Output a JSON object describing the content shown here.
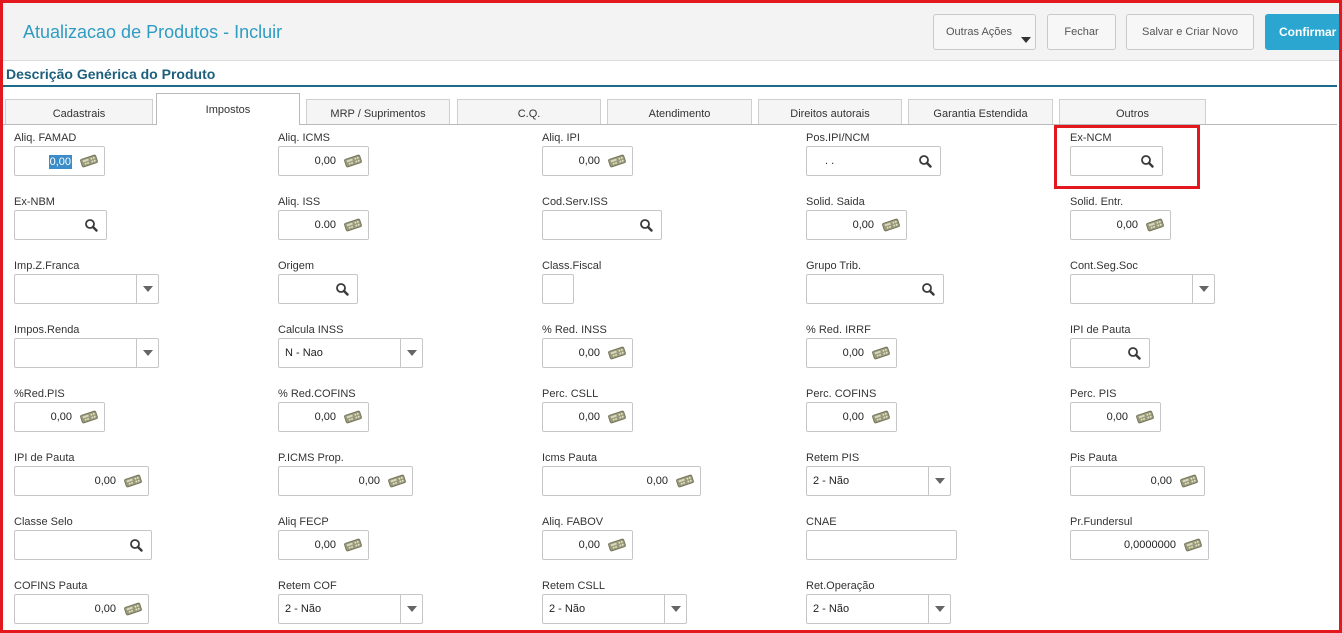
{
  "header": {
    "title": "Atualizacao de Produtos - Incluir",
    "buttons": {
      "outras": "Outras Ações",
      "fechar": "Fechar",
      "salvar": "Salvar e Criar Novo",
      "confirmar": "Confirmar"
    }
  },
  "section": {
    "title": "Descrição Genérica do Produto"
  },
  "tabs": [
    {
      "label": "Cadastrais"
    },
    {
      "label": "Impostos"
    },
    {
      "label": "MRP / Suprimentos"
    },
    {
      "label": "C.Q."
    },
    {
      "label": "Atendimento"
    },
    {
      "label": "Direitos autorais"
    },
    {
      "label": "Garantia Estendida"
    },
    {
      "label": "Outros"
    }
  ],
  "active_tab": "Impostos",
  "fields": {
    "aliq_famad": {
      "label": "Aliq. FAMAD",
      "value": "0,00"
    },
    "aliq_icms": {
      "label": "Aliq. ICMS",
      "value": "0,00"
    },
    "aliq_ipi": {
      "label": "Aliq. IPI",
      "value": "0,00"
    },
    "pos_ipi_ncm": {
      "label": "Pos.IPI/NCM",
      "value": ". ."
    },
    "ex_ncm": {
      "label": "Ex-NCM",
      "value": ""
    },
    "ex_nbm": {
      "label": "Ex-NBM",
      "value": ""
    },
    "aliq_iss": {
      "label": "Aliq. ISS",
      "value": "0.00"
    },
    "cod_serv_iss": {
      "label": "Cod.Serv.ISS",
      "value": ""
    },
    "solid_saida": {
      "label": "Solid. Saida",
      "value": "0,00"
    },
    "solid_entr": {
      "label": "Solid. Entr.",
      "value": "0,00"
    },
    "imp_z_franca": {
      "label": "Imp.Z.Franca",
      "value": ""
    },
    "origem": {
      "label": "Origem",
      "value": ""
    },
    "class_fiscal": {
      "label": "Class.Fiscal",
      "value": ""
    },
    "grupo_trib": {
      "label": "Grupo Trib.",
      "value": ""
    },
    "cont_seg_soc": {
      "label": "Cont.Seg.Soc",
      "value": ""
    },
    "impos_renda": {
      "label": "Impos.Renda",
      "value": ""
    },
    "calcula_inss": {
      "label": "Calcula INSS",
      "value": "N - Nao"
    },
    "red_inss": {
      "label": "% Red. INSS",
      "value": "0,00"
    },
    "red_irrf": {
      "label": "% Red. IRRF",
      "value": "0,00"
    },
    "ipi_pauta_1": {
      "label": "IPI de Pauta",
      "value": ""
    },
    "red_pis": {
      "label": "%Red.PIS",
      "value": "0,00"
    },
    "red_cofins": {
      "label": "% Red.COFINS",
      "value": "0,00"
    },
    "perc_csll": {
      "label": "Perc. CSLL",
      "value": "0,00"
    },
    "perc_cofins": {
      "label": "Perc. COFINS",
      "value": "0,00"
    },
    "perc_pis": {
      "label": "Perc. PIS",
      "value": "0,00"
    },
    "ipi_pauta_2": {
      "label": "IPI de Pauta",
      "value": "0,00"
    },
    "p_icms_prop": {
      "label": "P.ICMS Prop.",
      "value": "0,00"
    },
    "icms_pauta": {
      "label": "Icms Pauta",
      "value": "0,00"
    },
    "retem_pis": {
      "label": "Retem PIS",
      "value": "2 - Não"
    },
    "pis_pauta": {
      "label": "Pis Pauta",
      "value": "0,00"
    },
    "classe_selo": {
      "label": "Classe Selo",
      "value": ""
    },
    "aliq_fecp": {
      "label": "Aliq FECP",
      "value": "0,00"
    },
    "aliq_fabov": {
      "label": "Aliq. FABOV",
      "value": "0,00"
    },
    "cnae": {
      "label": "CNAE",
      "value": ""
    },
    "pr_fundersul": {
      "label": "Pr.Fundersul",
      "value": "0,0000000"
    },
    "cofins_pauta": {
      "label": "COFINS Pauta",
      "value": "0,00"
    },
    "retem_cof": {
      "label": "Retem COF",
      "value": "2 - Não"
    },
    "retem_csll": {
      "label": "Retem CSLL",
      "value": "2 - Não"
    },
    "ret_operacao": {
      "label": "Ret.Operação",
      "value": "2 - Não"
    }
  },
  "icons": {
    "calculator": "calculator-icon",
    "lookup": "search-icon",
    "dropdown": "chevron-down-icon"
  },
  "colors": {
    "title": "#2f9cc2",
    "confirm": "#2aa6d1",
    "section": "#1d5f7c",
    "highlight": "#e3171e"
  }
}
